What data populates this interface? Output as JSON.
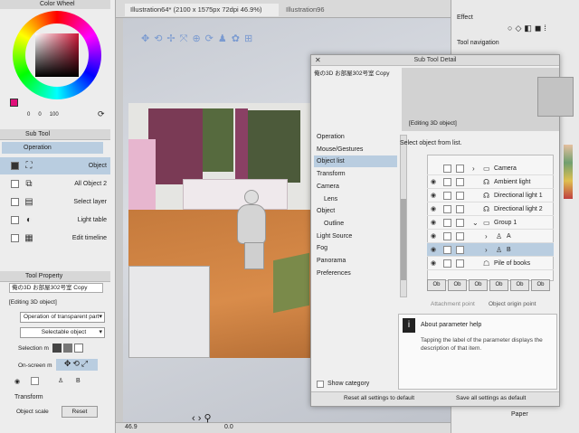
{
  "color_wheel": {
    "title": "Color Wheel",
    "values": [
      "0",
      "0",
      "100"
    ]
  },
  "sub_tool": {
    "title": "Sub Tool",
    "tab_label": "Operation",
    "items": [
      {
        "label": "Object",
        "checked": true,
        "selected": true
      },
      {
        "label": "All Object 2",
        "checked": false,
        "selected": false
      },
      {
        "label": "Select layer",
        "checked": false,
        "selected": false
      },
      {
        "label": "Light table",
        "checked": false,
        "selected": false
      },
      {
        "label": "Edit timeline",
        "checked": false,
        "selected": false
      }
    ]
  },
  "tool_property": {
    "title": "Tool Property",
    "header": "俺の3D お部屋302号室 Copy",
    "editing": "[Editing 3D object]",
    "dropdown1": "Operation of transparent part",
    "dropdown2": "Selectable object",
    "selection_mode_label": "Selection m",
    "onscreen_label": "On-screen m",
    "layer_label": "B",
    "transform_label": "Transform",
    "object_scale_label": "Object scale",
    "reset_label": "Reset"
  },
  "tabs": [
    "Illustration64* (2100 x 1575px 72dpi 46.9%)",
    "Illustration96"
  ],
  "status": {
    "zoom": "46.9",
    "angle": "0.0"
  },
  "right_panel": {
    "effect_label": "Effect",
    "tool_nav_label": "Tool navigation",
    "paper_label": "Paper"
  },
  "dialog": {
    "title": "Sub Tool Detail",
    "header": "俺の3D お部屋302号室 Copy",
    "editing": "[Editing 3D object]",
    "categories": [
      {
        "label": "Operation",
        "selected": false
      },
      {
        "label": "Mouse/Gestures",
        "selected": false
      },
      {
        "label": "Object list",
        "selected": true
      },
      {
        "label": "Transform",
        "selected": false
      },
      {
        "label": "Camera",
        "selected": false
      },
      {
        "label": "Lens",
        "selected": false
      },
      {
        "label": "Object",
        "selected": false
      },
      {
        "label": "Outline",
        "selected": false
      },
      {
        "label": "Light Source",
        "selected": false
      },
      {
        "label": "Fog",
        "selected": false
      },
      {
        "label": "Panorama",
        "selected": false
      },
      {
        "label": "Preferences",
        "selected": false
      }
    ],
    "instruction": "Select object from list.",
    "objects": [
      {
        "name": "Camera",
        "icon": "folder-icon",
        "eye": false,
        "expanded": false,
        "selected": false
      },
      {
        "name": "Ambient light",
        "icon": "light-icon",
        "eye": true,
        "expanded": false,
        "selected": false
      },
      {
        "name": "Directional light 1",
        "icon": "light-icon",
        "eye": true,
        "expanded": false,
        "selected": false
      },
      {
        "name": "Directional light 2",
        "icon": "light-icon",
        "eye": true,
        "expanded": false,
        "selected": false
      },
      {
        "name": "Group 1",
        "icon": "folder-icon",
        "eye": true,
        "expanded": true,
        "selected": false
      },
      {
        "name": "A",
        "icon": "figure-icon",
        "eye": true,
        "expanded": false,
        "selected": false
      },
      {
        "name": "B",
        "icon": "figure-icon",
        "eye": true,
        "expanded": false,
        "selected": true
      },
      {
        "name": "Pile of books",
        "icon": "object-icon",
        "eye": true,
        "expanded": false,
        "selected": false
      }
    ],
    "toolbar_buttons": [
      "Ob",
      "Ob",
      "Ob",
      "Ob",
      "Ob",
      "Ob"
    ],
    "attachment_label": "Attachment point",
    "origin_label": "Object origin point",
    "help_title": "About parameter help",
    "help_text": "Tapping the label of the parameter displays the description of that item.",
    "show_category": "Show category",
    "reset_all": "Reset all settings to default",
    "save_all": "Save all settings as default"
  },
  "colors": {
    "selection": "#b9cde0",
    "accent_magenta": "#e0107a"
  }
}
